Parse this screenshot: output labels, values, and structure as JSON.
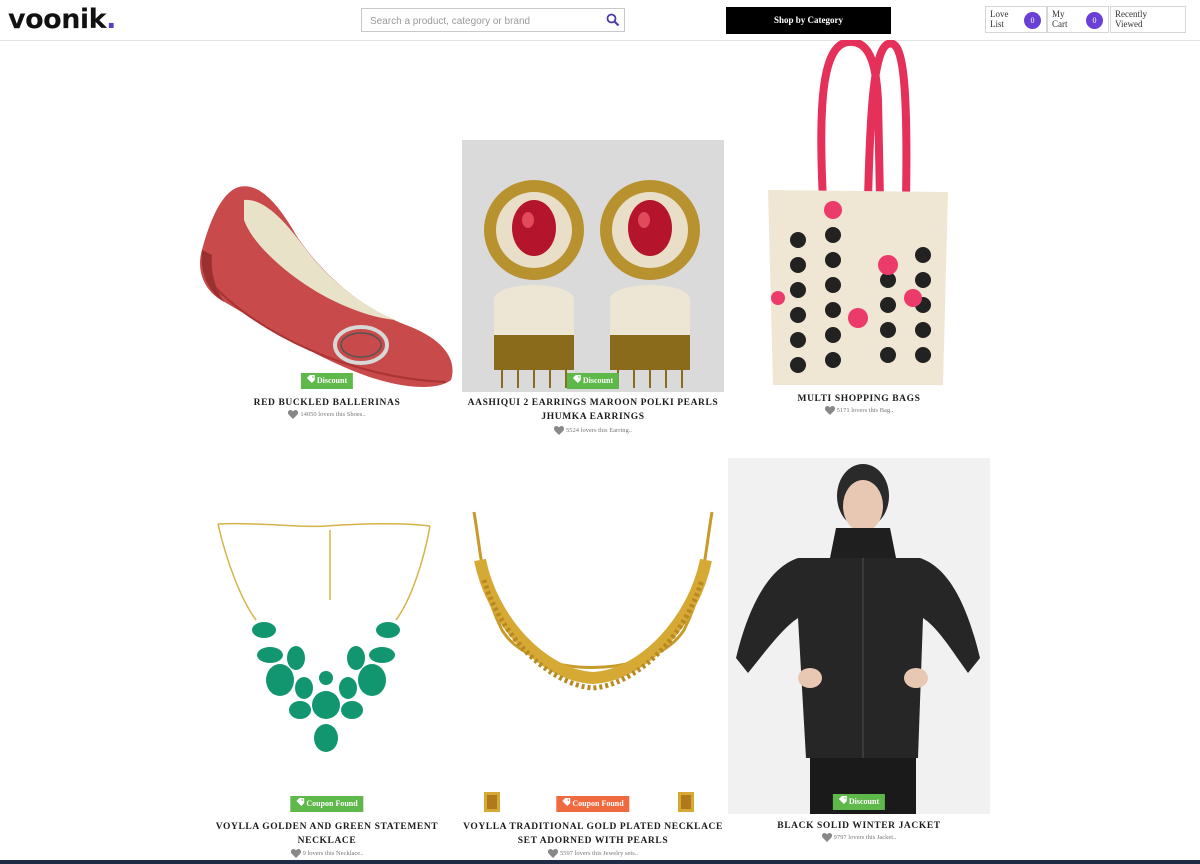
{
  "header": {
    "logo": "voonik",
    "logo_dot": ".",
    "search_placeholder": "Search a product, category or brand",
    "shop_by_category": "Shop by Category",
    "love_list_label": "Love List",
    "love_list_count": "0",
    "cart_label": "My Cart",
    "cart_count": "0",
    "recently_viewed_label": "Recently Viewed"
  },
  "products": [
    {
      "title": "Red Buckled Ballerinas",
      "badge": "Discount",
      "lovers": "14050 lovers this Shoes.."
    },
    {
      "title": "Aashiqui 2 Earrings Maroon Polki Pearls Jhumka Earrings",
      "badge": "Discount",
      "lovers": "5524 lovers this Earring.."
    },
    {
      "title": "Multi Shopping Bags",
      "badge": "",
      "lovers": "5171 lovers this Bag.."
    },
    {
      "title": "Voylla Golden And Green Statement Necklace",
      "badge": "Coupon Found",
      "lovers": "9 lovers this Necklace.."
    },
    {
      "title": "Voylla Traditional Gold Plated Necklace Set Adorned With Pearls",
      "badge": "Coupon Found",
      "lovers": "5597 lovers this Jewelry sets.."
    },
    {
      "title": "Black Solid Winter Jacket",
      "badge": "Discount",
      "lovers": "9797 lovers this Jacket.."
    }
  ],
  "colors": {
    "accent": "#6a3fd6",
    "discount": "#5fb84a",
    "coupon": "#f06a3f"
  },
  "icons": [
    "search-icon",
    "heart-icon",
    "tag-icon"
  ]
}
